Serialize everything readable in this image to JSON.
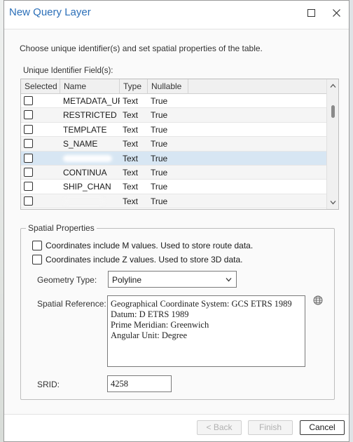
{
  "window": {
    "title": "New Query Layer"
  },
  "intro": {
    "instructions": "Choose unique identifier(s) and set spatial properties of the table.",
    "uid_label": "Unique Identifier Field(s):"
  },
  "grid": {
    "columns": [
      "Selected",
      "Name",
      "Type",
      "Nullable"
    ],
    "rows": [
      {
        "name": "METADATA_URL",
        "type": "Text",
        "nullable": "True",
        "selected": false
      },
      {
        "name": "RESTRICTED",
        "type": "Text",
        "nullable": "True",
        "selected": false
      },
      {
        "name": "TEMPLATE",
        "type": "Text",
        "nullable": "True",
        "selected": false
      },
      {
        "name": "S_NAME",
        "type": "Text",
        "nullable": "True",
        "selected": false
      },
      {
        "name": "",
        "type": "Text",
        "nullable": "True",
        "selected": false,
        "highlighted": true,
        "redacted": true
      },
      {
        "name": "CONTINUA",
        "type": "Text",
        "nullable": "True",
        "selected": false
      },
      {
        "name": "SHIP_CHAN",
        "type": "Text",
        "nullable": "True",
        "selected": false
      },
      {
        "name": "",
        "type": "Text",
        "nullable": "True",
        "selected": false,
        "redacted": true
      }
    ]
  },
  "spatial": {
    "group_title": "Spatial Properties",
    "m_values_label": "Coordinates include M values. Used to store route data.",
    "z_values_label": "Coordinates include Z values. Used to store 3D data.",
    "geometry_type_label": "Geometry Type:",
    "geometry_type_value": "Polyline",
    "spatial_reference_label": "Spatial Reference:",
    "spatial_reference_lines": [
      "Geographical Coordinate System:  GCS ETRS 1989",
      "Datum:  D ETRS 1989",
      "Prime Meridian:  Greenwich",
      "Angular Unit:  Degree"
    ],
    "srid_label": "SRID:",
    "srid_value": "4258"
  },
  "buttons": {
    "back": "< Back",
    "finish": "Finish",
    "cancel": "Cancel"
  },
  "colors": {
    "title": "#2b6fb8",
    "selected_row": "#d7e6f3"
  }
}
